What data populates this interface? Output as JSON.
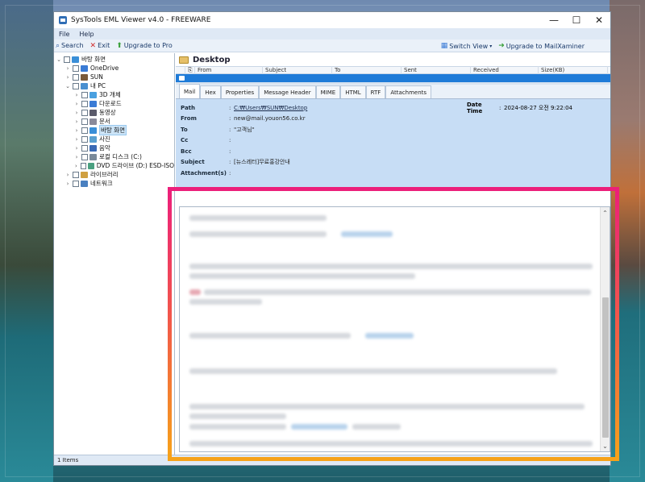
{
  "window": {
    "title": "SysTools EML Viewer v4.0 - FREEWARE",
    "controls": {
      "minimize": "—",
      "maximize": "☐",
      "close": "✕"
    }
  },
  "menu": {
    "items": [
      "File",
      "Help"
    ]
  },
  "toolbar": {
    "search": "Search",
    "exit": "Exit",
    "upgrade_pro": "Upgrade to Pro",
    "switch_view": "Switch View",
    "upgrade_mailxaminer": "Upgrade to MailXaminer"
  },
  "tree": {
    "items": [
      {
        "label": "바탕 화면",
        "toggle": "⌄",
        "icon_color": "#3a8fd8",
        "indent": 0
      },
      {
        "label": "OneDrive",
        "toggle": "›",
        "icon_color": "#3a7bd5",
        "indent": 1
      },
      {
        "label": "SUN",
        "toggle": "›",
        "icon_color": "#7a5a3a",
        "indent": 1
      },
      {
        "label": "내 PC",
        "toggle": "⌄",
        "icon_color": "#4a90d0",
        "indent": 1
      },
      {
        "label": "3D 개체",
        "toggle": "›",
        "icon_color": "#4aa0e0",
        "indent": 2
      },
      {
        "label": "다운로드",
        "toggle": "›",
        "icon_color": "#3a7bd5",
        "indent": 2
      },
      {
        "label": "동영상",
        "toggle": "›",
        "icon_color": "#5a5a6a",
        "indent": 2
      },
      {
        "label": "문서",
        "toggle": "›",
        "icon_color": "#8a8a9a",
        "indent": 2
      },
      {
        "label": "바탕 화면",
        "toggle": "›",
        "icon_color": "#3a8fd8",
        "indent": 2,
        "selected": true
      },
      {
        "label": "사진",
        "toggle": "›",
        "icon_color": "#5aa0d0",
        "indent": 2
      },
      {
        "label": "음악",
        "toggle": "›",
        "icon_color": "#3a6ab5",
        "indent": 2
      },
      {
        "label": "로컬 디스크 (C:)",
        "toggle": "›",
        "icon_color": "#7a8a9a",
        "indent": 2
      },
      {
        "label": "DVD 드라이브 (D:) ESD-ISO",
        "toggle": "›",
        "icon_color": "#4aa080",
        "indent": 2
      },
      {
        "label": "라이브러리",
        "toggle": "›",
        "icon_color": "#d0a040",
        "indent": 1
      },
      {
        "label": "네트워크",
        "toggle": "›",
        "icon_color": "#4a80c0",
        "indent": 1
      }
    ]
  },
  "pane": {
    "title": "Desktop",
    "columns": [
      "From",
      "Subject",
      "To",
      "Sent",
      "Received",
      "Size(KB)"
    ]
  },
  "tabs": [
    "Mail",
    "Hex",
    "Properties",
    "Message Header",
    "MIME",
    "HTML",
    "RTF",
    "Attachments"
  ],
  "mail": {
    "path_label": "Path",
    "path_value": "C:₩Users₩SUN₩Desktop",
    "from_label": "From",
    "from_value": "new@mail.youon56.co.kr",
    "to_label": "To",
    "to_value": "\"고객님\"",
    "cc_label": "Cc",
    "cc_value": "",
    "bcc_label": "Bcc",
    "bcc_value": "",
    "subject_label": "Subject",
    "subject_value": "[뉴스레터]무료홍강안내",
    "attachments_label": "Attachment(s)",
    "attachments_value": "",
    "date_label": "Date Time",
    "date_value": "2024-08-27 오전 9:22:04"
  },
  "status": {
    "text": "1 Items"
  },
  "colors": {
    "accent": "#1e7bd8",
    "header_bg": "#c7ddf5",
    "highlight_top": "#ec1f7a",
    "highlight_bottom": "#f6a21a"
  }
}
